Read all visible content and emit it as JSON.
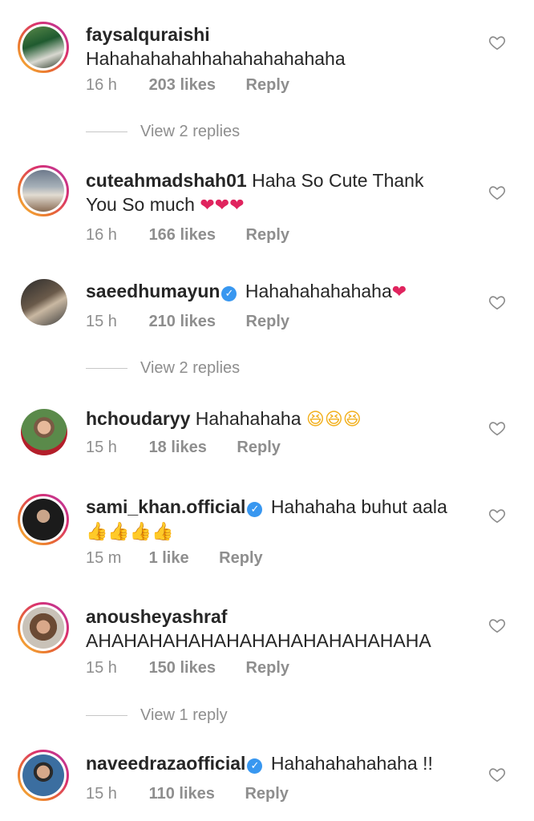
{
  "comments": [
    {
      "username": "faysalquraishi",
      "verified": false,
      "text": "",
      "second_line": "Hahahahahahhahahahahahaha",
      "emoji": "",
      "time": "16 h",
      "likes": "203 likes",
      "reply": "Reply",
      "replies": "View 2 replies"
    },
    {
      "username": "cuteahmadshah01",
      "verified": false,
      "text": "Haha So Cute Thank",
      "second_line": "You So much",
      "emoji": "❤❤❤",
      "time": "16 h",
      "likes": "166 likes",
      "reply": "Reply",
      "replies": ""
    },
    {
      "username": "saeedhumayun",
      "verified": true,
      "text": "Hahahahahahaha",
      "second_line": "",
      "emoji": "❤",
      "time": "15 h",
      "likes": "210 likes",
      "reply": "Reply",
      "replies": "View 2 replies"
    },
    {
      "username": "hchoudaryy",
      "verified": false,
      "text": "Hahahahaha",
      "second_line": "",
      "emoji": "😆😆😆",
      "time": "15 h",
      "likes": "18 likes",
      "reply": "Reply",
      "replies": ""
    },
    {
      "username": "sami_khan.official",
      "verified": true,
      "text": "Hahahaha buhut aala",
      "second_line": "",
      "emoji": "👍👍👍👍",
      "time": "15 m",
      "likes": "1 like",
      "reply": "Reply",
      "replies": ""
    },
    {
      "username": "anousheyashraf",
      "verified": false,
      "text": "",
      "second_line": "AHAHAHAHAHAHAHAHAHAHAHAHAHA",
      "emoji": "",
      "time": "15 h",
      "likes": "150 likes",
      "reply": "Reply",
      "replies": "View 1 reply"
    },
    {
      "username": "naveedrazaofficial",
      "verified": true,
      "text": "Hahahahahahaha !!",
      "second_line": "",
      "emoji": "",
      "time": "15 h",
      "likes": "110 likes",
      "reply": "Reply",
      "replies": ""
    }
  ],
  "icons": {
    "like": "heart-outline-icon",
    "verified": "verified-badge-icon"
  },
  "colors": {
    "meta": "#8e8e8e",
    "verified": "#3897f0",
    "story_ring": "#d9306f"
  }
}
